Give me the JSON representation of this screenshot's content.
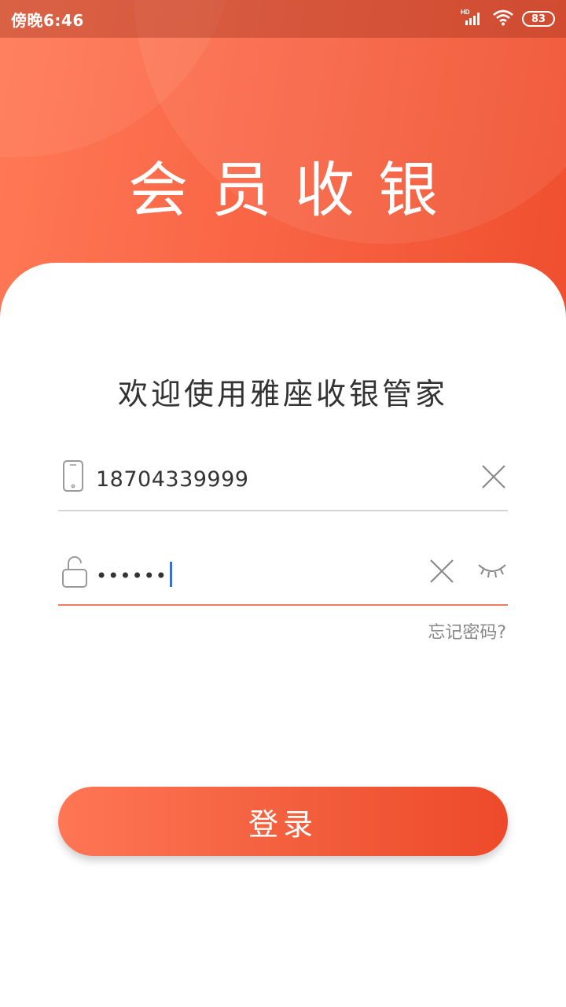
{
  "status_bar": {
    "time": "傍晚6:46",
    "network": "HD",
    "battery": "83"
  },
  "header": {
    "title": "会员收银"
  },
  "welcome": "欢迎使用雅座收银管家",
  "form": {
    "phone_value": "18704339999",
    "password_value": "••••••",
    "forgot_label": "忘记密码?"
  },
  "login_label": "登录",
  "colors": {
    "accent": "#f25e3c",
    "accent_light": "#ff7655",
    "caret": "#3b6fd8"
  },
  "icons": {
    "phone": "phone-icon",
    "lock": "lock-icon",
    "clear": "close-icon",
    "eye": "eye-closed-icon"
  }
}
